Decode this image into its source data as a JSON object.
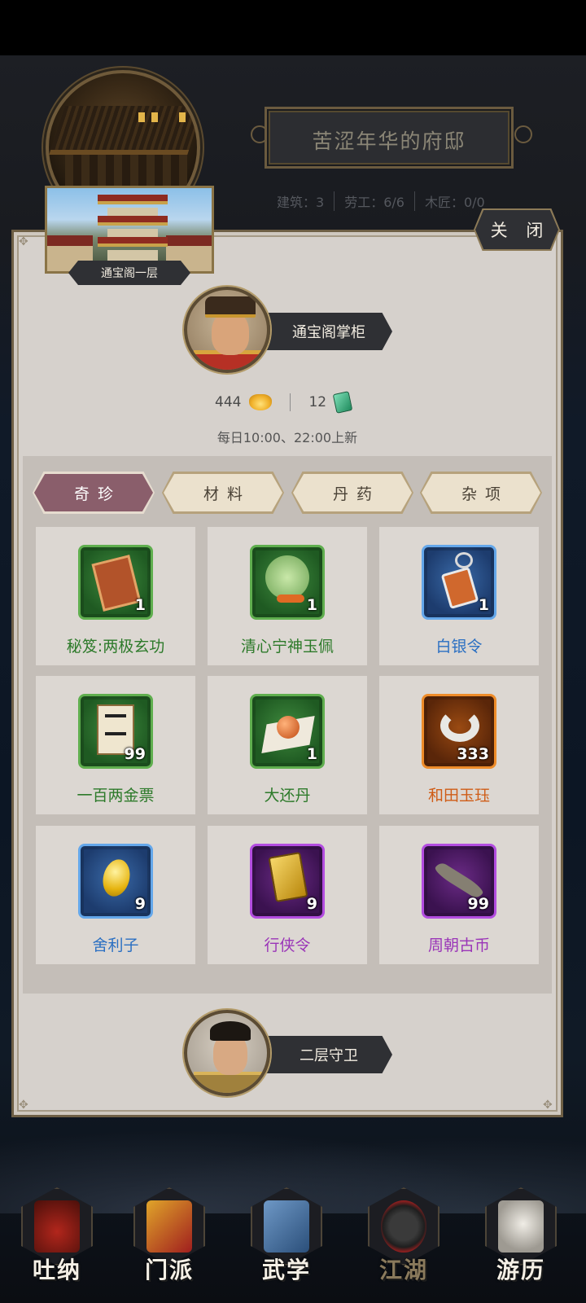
{
  "header": {
    "residence_title": "苦涩年华的府邸",
    "stats": [
      "建筑：3",
      "劳工：6/6",
      "木匠：0/0"
    ]
  },
  "panel": {
    "close_label": "关 闭",
    "floor_label": "通宝阁一层",
    "shopkeeper_label": "通宝阁掌柜",
    "currency": {
      "gold": "444",
      "jade": "12",
      "gold_icon": "gold-ingot-icon",
      "jade_icon": "jade-token-icon"
    },
    "refresh_note": "每日10:00、22:00上新",
    "tabs": [
      {
        "label": "奇珍",
        "active": true
      },
      {
        "label": "材料",
        "active": false
      },
      {
        "label": "丹药",
        "active": false
      },
      {
        "label": "杂项",
        "active": false
      }
    ],
    "items": [
      {
        "name": "秘笈:两极玄功",
        "qty": "1",
        "quality": "green",
        "icon": "scroll-book-icon"
      },
      {
        "name": "清心宁神玉佩",
        "qty": "1",
        "quality": "green",
        "icon": "jade-pendant-icon"
      },
      {
        "name": "白银令",
        "qty": "1",
        "quality": "blue",
        "icon": "silver-token-icon"
      },
      {
        "name": "一百两金票",
        "qty": "99",
        "quality": "green",
        "icon": "banknote-icon"
      },
      {
        "name": "大还丹",
        "qty": "1",
        "quality": "green",
        "icon": "pill-icon"
      },
      {
        "name": "和田玉珏",
        "qty": "333",
        "quality": "orange",
        "icon": "jade-ring-icon"
      },
      {
        "name": "舍利子",
        "qty": "9",
        "quality": "blue",
        "icon": "relic-icon"
      },
      {
        "name": "行侠令",
        "qty": "9",
        "quality": "purple",
        "icon": "gold-plaque-icon"
      },
      {
        "name": "周朝古币",
        "qty": "99",
        "quality": "purple",
        "icon": "ancient-coin-icon"
      }
    ],
    "guard_label": "二层守卫"
  },
  "nav": [
    {
      "label": "吐纳",
      "icon": "meditation-icon",
      "active": false
    },
    {
      "label": "门派",
      "icon": "sect-banner-icon",
      "active": false
    },
    {
      "label": "武学",
      "icon": "martial-book-icon",
      "active": false
    },
    {
      "label": "江湖",
      "icon": "straw-hat-icon",
      "active": true
    },
    {
      "label": "游历",
      "icon": "horse-icon",
      "active": false
    }
  ],
  "colors": {
    "panel_bg": "#d6d1cc",
    "tab_active": "#8a5e6b",
    "quality_green": "#2d7a2a",
    "quality_blue": "#2a6fc2",
    "quality_orange": "#cf5c16",
    "quality_purple": "#9a35b8"
  }
}
